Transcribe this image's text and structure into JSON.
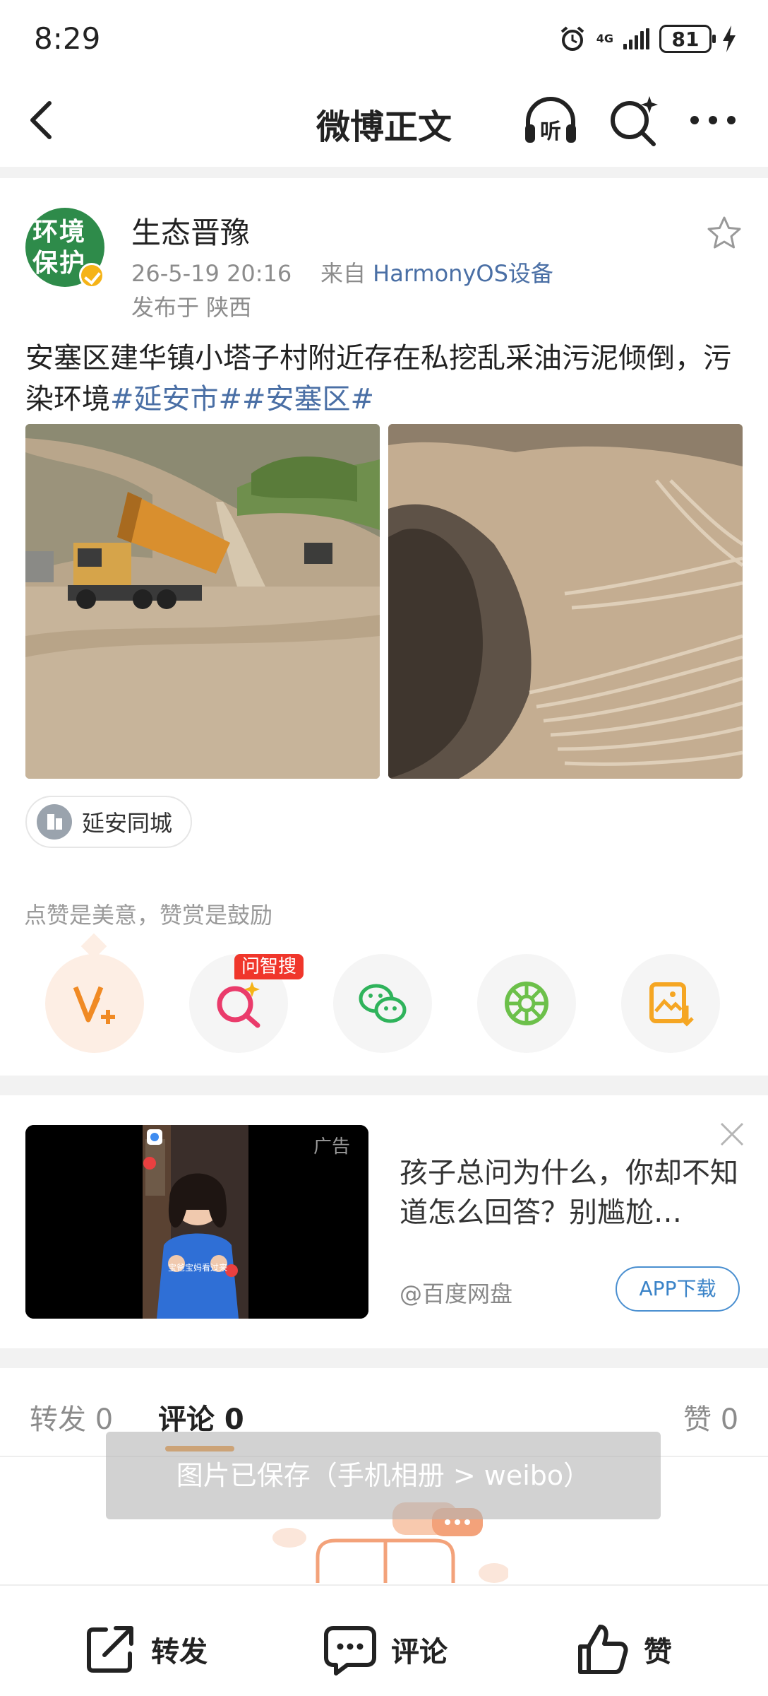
{
  "status_bar": {
    "time": "8:29",
    "network": "4G",
    "battery": "81",
    "icons": [
      "alarm-icon",
      "signal-icon",
      "battery-icon",
      "charging-icon"
    ]
  },
  "nav": {
    "title": "微博正文",
    "listen_label": "听",
    "icons": [
      "back-icon",
      "listen-icon",
      "ai-search-icon",
      "more-icon"
    ]
  },
  "post": {
    "avatar_text": "环境保护",
    "user_name": "生态晋豫",
    "time": "26-5-19 20:16",
    "from_label": "来自",
    "source": "HarmonyOS设备",
    "location": "发布于 陕西",
    "text": "安塞区建华镇小塔子村附近存在私挖乱采油污泥倾倒，污染环境",
    "tags": "#延安市##安塞区#",
    "location_chip": "延安同城"
  },
  "reward": {
    "hint": "点赞是美意，赞赏是鼓励",
    "ask_badge": "问智搜",
    "actions": [
      "vplus-reward-icon",
      "ask-search-icon",
      "wechat-icon",
      "moments-icon",
      "save-image-icon"
    ]
  },
  "ad": {
    "tag": "广告",
    "title": "孩子总问为什么，你却不知道怎么回答？别尴尬…",
    "source": "@百度网盘",
    "button": "APP下载",
    "caption": "宝爸宝妈看过来"
  },
  "tabs": {
    "repost": "转发 0",
    "comment": "评论 0",
    "like": "赞 0"
  },
  "toast": "图片已保存（手机相册 > weibo）",
  "bottom_bar": {
    "repost": "转发",
    "comment": "评论",
    "like": "赞"
  },
  "colors": {
    "link": "#4a6fa5",
    "accent": "#f18b1c",
    "badge_red": "#f0362b",
    "verified": "#f5b317"
  }
}
